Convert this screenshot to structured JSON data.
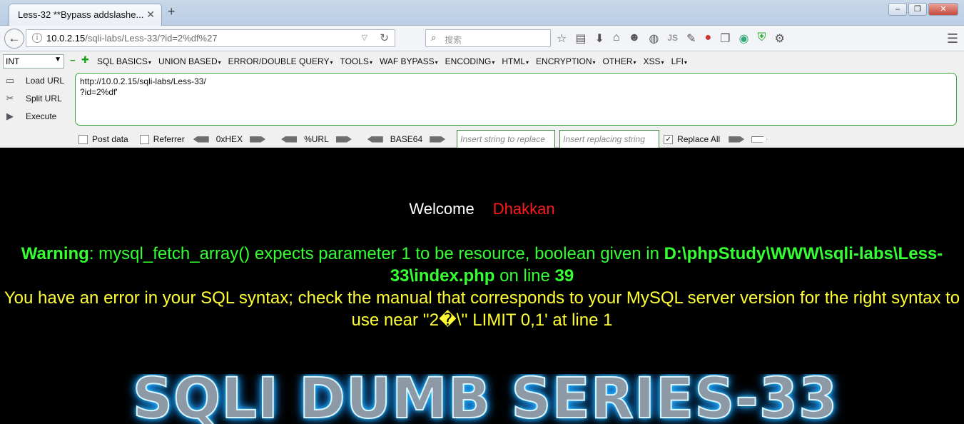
{
  "browser": {
    "tab_title": "Less-32 **Bypass addslashe...",
    "tab_close": "✕",
    "new_tab": "+",
    "url_host": "10.0.2.15",
    "url_path": "/sqli-labs/Less-33/?id=2%df%27",
    "search_placeholder": "搜索",
    "addon_js": "JS"
  },
  "hackbar": {
    "type_select": "INT",
    "menu": [
      "SQL BASICS",
      "UNION BASED",
      "ERROR/DOUBLE QUERY",
      "TOOLS",
      "WAF BYPASS",
      "ENCODING",
      "HTML",
      "ENCRYPTION",
      "OTHER",
      "XSS",
      "LFI"
    ],
    "load_url": "Load URL",
    "split_url": "Split URL",
    "execute": "Execute",
    "url_value": "http://10.0.2.15/sqli-labs/Less-33/\n?id=2%df'",
    "post_data": "Post data",
    "referrer": "Referrer",
    "hex": "0xHEX",
    "url_enc": "%URL",
    "base64": "BASE64",
    "insert_placeholder": "Insert string to replace",
    "replace_placeholder": "Insert replacing string",
    "replace_all": "Replace All",
    "replace_all_checked": true
  },
  "page": {
    "welcome": "Welcome",
    "name": "Dhakkan",
    "warning_label": "Warning",
    "warning_text": ": mysql_fetch_array() expects parameter 1 to be resource, boolean given in ",
    "warning_path": "D:\\phpStudy\\WWW\\sqli-labs\\Less-33\\index.php",
    "warning_online": " on line ",
    "warning_line": "39",
    "sql_error": "You have an error in your SQL syntax; check the manual that corresponds to your MySQL server version for the right syntax to use near ''2�\\'' LIMIT 0,1' at line 1",
    "banner": "SQLI DUMB SERIES-33"
  },
  "colors": {
    "welcome": "#ffffff",
    "name": "#ff1a1a",
    "warning": "#33ff33",
    "sql_error": "#ffff33",
    "background": "#000000"
  }
}
